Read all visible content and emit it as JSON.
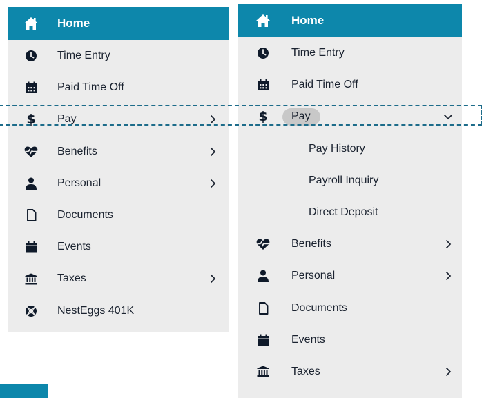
{
  "left_menu": {
    "header": {
      "label": "Home",
      "icon": "home-icon"
    },
    "items": [
      {
        "label": "Time Entry",
        "icon": "clock-icon",
        "has_chevron": false
      },
      {
        "label": "Paid Time Off",
        "icon": "calendar-grid-icon",
        "has_chevron": false
      },
      {
        "label": "Pay",
        "icon": "dollar-icon",
        "has_chevron": true
      },
      {
        "label": "Benefits",
        "icon": "heartbeat-icon",
        "has_chevron": true
      },
      {
        "label": "Personal",
        "icon": "person-icon",
        "has_chevron": true
      },
      {
        "label": "Documents",
        "icon": "document-icon",
        "has_chevron": false
      },
      {
        "label": "Events",
        "icon": "calendar-icon",
        "has_chevron": false
      },
      {
        "label": "Taxes",
        "icon": "bank-icon",
        "has_chevron": true
      },
      {
        "label": "NestEggs 401K",
        "icon": "life-ring-icon",
        "has_chevron": false
      }
    ]
  },
  "right_menu": {
    "header": {
      "label": "Home",
      "icon": "home-icon"
    },
    "items": [
      {
        "label": "Time Entry",
        "icon": "clock-icon"
      },
      {
        "label": "Paid Time Off",
        "icon": "calendar-grid-icon"
      },
      {
        "label": "Pay",
        "icon": "dollar-icon",
        "expanded": true
      },
      {
        "label": "Benefits",
        "icon": "heartbeat-icon"
      },
      {
        "label": "Personal",
        "icon": "person-icon"
      },
      {
        "label": "Documents",
        "icon": "document-icon"
      },
      {
        "label": "Events",
        "icon": "calendar-icon"
      },
      {
        "label": "Taxes",
        "icon": "bank-icon"
      }
    ],
    "pay_submenu": [
      {
        "label": "Pay History"
      },
      {
        "label": "Payroll Inquiry"
      },
      {
        "label": "Direct Deposit"
      }
    ]
  },
  "colors": {
    "header_bg": "#0d87ab",
    "panel_bg": "#ececec",
    "highlight_dash": "#1d6c8a",
    "active_pill": "#c8c8c8"
  }
}
